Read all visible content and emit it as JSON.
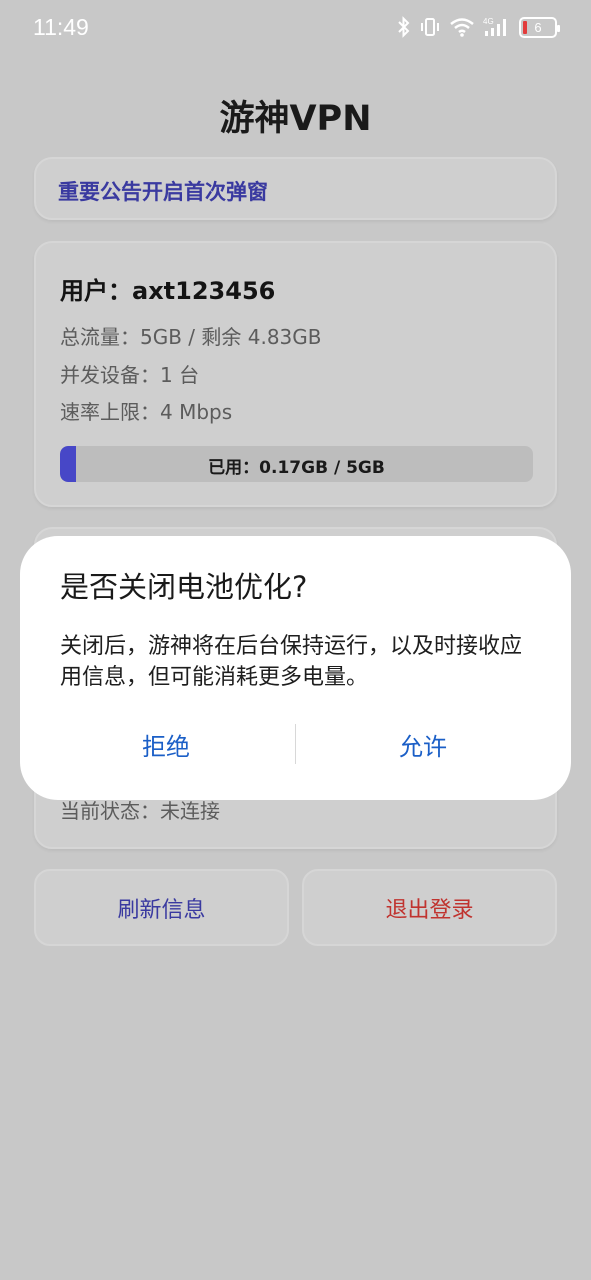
{
  "status_bar": {
    "time": "11:49",
    "battery_level": "6",
    "icons": [
      "bluetooth-icon",
      "vibrate-icon",
      "wifi-icon",
      "signal-4g-icon",
      "battery-icon"
    ],
    "battery_color": "#e23b3b"
  },
  "app": {
    "title": "游神VPN"
  },
  "notice": {
    "text": "重要公告开启首次弹窗"
  },
  "user": {
    "name_line": "用户：axt123456",
    "total_traffic": "总流量：5GB / 剩余 4.83GB",
    "devices": "并发设备：1 台",
    "speed_limit": "速率上限：4 Mbps",
    "usage_label": "已用：0.17GB / 5GB",
    "usage_fraction": 0.034
  },
  "connection": {
    "status": "当前状态：未连接"
  },
  "actions": {
    "refresh": "刷新信息",
    "logout": "退出登录"
  },
  "dialog": {
    "title": "是否关闭电池优化?",
    "body": "关闭后，游神将在后台保持运行，以及时接收应用信息，但可能消耗更多电量。",
    "deny": "拒绝",
    "allow": "允许"
  },
  "colors": {
    "accent": "#3a3aa0",
    "danger": "#c0332f",
    "dialog_button": "#1b5fc7",
    "progress": "#4747c7"
  }
}
